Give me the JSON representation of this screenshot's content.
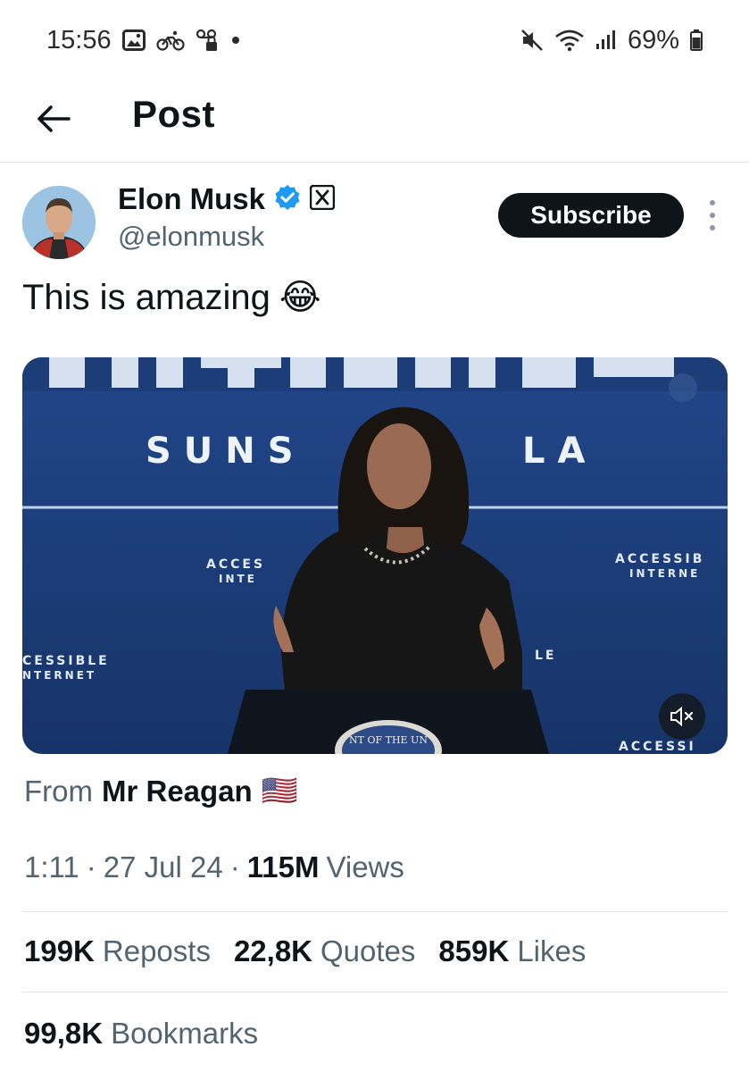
{
  "status_bar": {
    "time": "15:56",
    "battery": "69%",
    "icons_left": [
      "gallery-icon",
      "cycling-icon",
      "voicemail-lock-icon",
      "dot-icon"
    ],
    "icons_right": [
      "mute-icon",
      "wifi-icon",
      "signal-icon",
      "battery-icon"
    ]
  },
  "header": {
    "title": "Post"
  },
  "author": {
    "display_name": "Elon Musk",
    "handle": "@elonmusk",
    "verified": true,
    "affiliate_badge": "X"
  },
  "subscribe_label": "Subscribe",
  "post": {
    "text": "This is amazing",
    "emoji": "😂"
  },
  "media": {
    "backdrop_texts": [
      "SUNS",
      "LA",
      "ACCES",
      "INTE",
      "ACCESSIB",
      "INTERNE",
      "CESSIBLE",
      "NTERNET",
      "LE",
      "ACCESSI"
    ],
    "seal_text": "NT OF THE UN"
  },
  "from": {
    "prefix": "From",
    "name": "Mr Reagan",
    "flag": "🇺🇸"
  },
  "meta": {
    "time": "1:11",
    "date": "27 Jul 24",
    "views_count": "115M",
    "views_label": "Views"
  },
  "stats": [
    {
      "count": "199K",
      "label": "Reposts"
    },
    {
      "count": "22,8K",
      "label": "Quotes"
    },
    {
      "count": "859K",
      "label": "Likes"
    }
  ],
  "bookmarks": {
    "count": "99,8K",
    "label": "Bookmarks"
  },
  "colors": {
    "text": "#0f1419",
    "secondary": "#536471",
    "verified_blue": "#1d9bf0",
    "stage_blue": "#1c3d78"
  }
}
